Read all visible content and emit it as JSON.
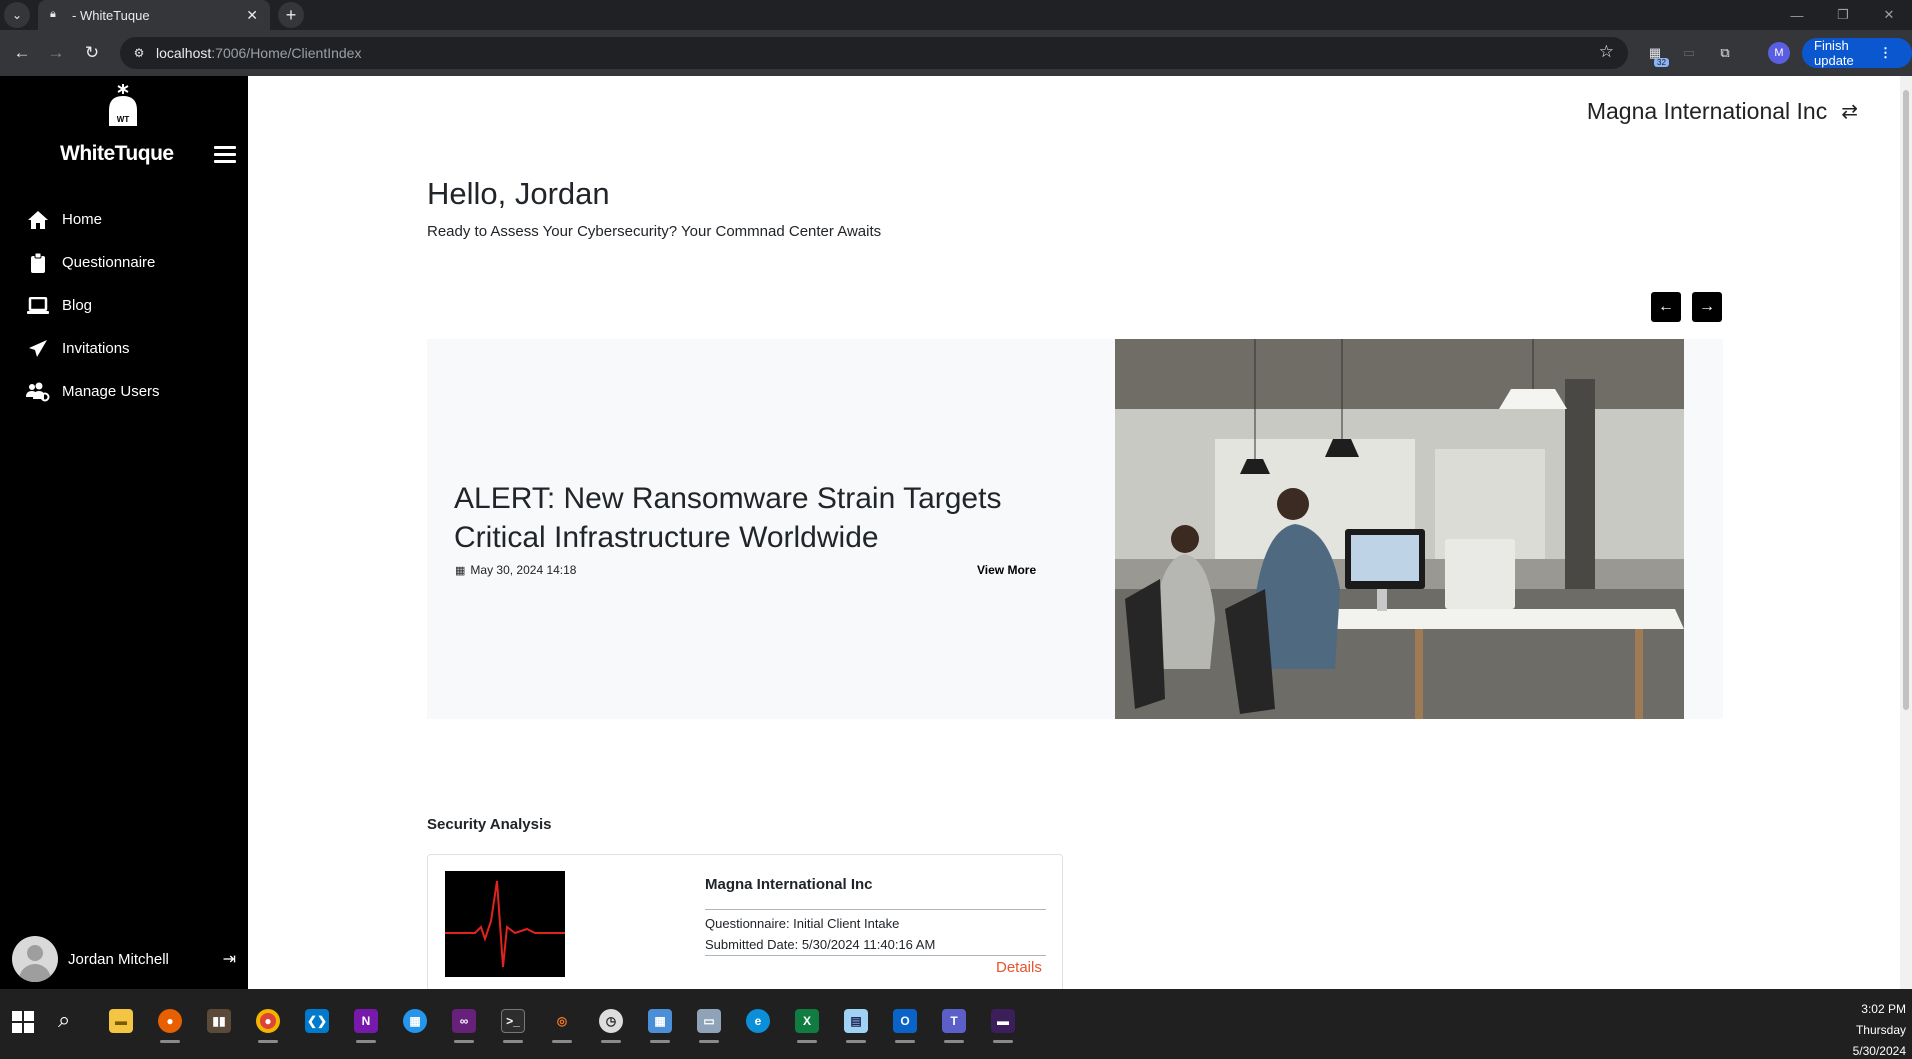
{
  "browser": {
    "tab_title": "- WhiteTuque",
    "url_host": "localhost",
    "url_path": ":7006/Home/ClientIndex",
    "extension_badge": "32",
    "profile_initial": "M",
    "finish_update_label": "Finish update"
  },
  "sidebar": {
    "brand": "WhiteTuque",
    "logo_text": "WT",
    "items": [
      {
        "label": "Home",
        "icon": "home-icon"
      },
      {
        "label": "Questionnaire",
        "icon": "clipboard-icon"
      },
      {
        "label": "Blog",
        "icon": "laptop-icon"
      },
      {
        "label": "Invitations",
        "icon": "paper-plane-icon"
      },
      {
        "label": "Manage Users",
        "icon": "users-gear-icon"
      }
    ],
    "user_name": "Jordan Mitchell"
  },
  "main": {
    "org_name": "Magna International Inc",
    "greeting": "Hello, Jordan",
    "subgreeting": "Ready to Assess Your Cybersecurity? Your Commnad Center Awaits",
    "carousel": {
      "headline": "ALERT: New Ransomware Strain Targets Critical Infrastructure Worldwide",
      "date": "May 30, 2024 14:18",
      "view_more": "View More"
    },
    "security_analysis": {
      "title": "Security Analysis",
      "company": "Magna International Inc",
      "questionnaire": "Questionnaire: Initial Client Intake",
      "submitted": "Submitted Date: 5/30/2024 11:40:16 AM",
      "details": "Details"
    }
  },
  "taskbar": {
    "time": "3:02 PM",
    "day": "Thursday",
    "date": "5/30/2024",
    "apps": [
      "file-explorer",
      "firefox",
      "library",
      "chrome",
      "vscode",
      "onenote",
      "docker",
      "visual-studio",
      "terminal",
      "jupyter",
      "clock",
      "calculator",
      "remote-desktop",
      "edge",
      "excel",
      "notepad",
      "outlook",
      "teams",
      "terminal-preview"
    ]
  },
  "colors": {
    "sidebar_bg": "#000000",
    "details_link": "#e8542b",
    "carousel_bg": "#f8f9fa"
  }
}
